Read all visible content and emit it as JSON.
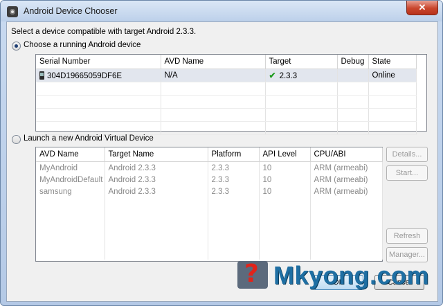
{
  "window": {
    "title": "Android Device Chooser",
    "close_label": "✕"
  },
  "instructions": "Select a device compatible with target Android 2.3.3.",
  "running": {
    "radio_label": "Choose a running Android device",
    "columns": [
      "Serial Number",
      "AVD Name",
      "Target",
      "Debug",
      "State"
    ],
    "rows": [
      {
        "serial": "304D19665059DF6E",
        "avd": "N/A",
        "target": "2.3.3",
        "debug": "",
        "state": "Online",
        "icon": "phone-icon",
        "target_icon": "check-icon"
      }
    ]
  },
  "launch": {
    "radio_label": "Launch a new Android Virtual Device",
    "columns": [
      "AVD Name",
      "Target Name",
      "Platform",
      "API Level",
      "CPU/ABI"
    ],
    "rows": [
      {
        "avd": "MyAndroid",
        "target": "Android 2.3.3",
        "platform": "2.3.3",
        "api": "10",
        "cpu": "ARM (armeabi)"
      },
      {
        "avd": "MyAndroidDefault",
        "target": "Android 2.3.3",
        "platform": "2.3.3",
        "api": "10",
        "cpu": "ARM (armeabi)"
      },
      {
        "avd": "samsung",
        "target": "Android 2.3.3",
        "platform": "2.3.3",
        "api": "10",
        "cpu": "ARM (armeabi)"
      }
    ],
    "buttons": {
      "details": "Details...",
      "start": "Start...",
      "refresh": "Refresh",
      "manager": "Manager..."
    }
  },
  "footer": {
    "ok": "OK",
    "cancel": "Cancel"
  },
  "watermark": {
    "text": "Mkyong.com",
    "glyph": "?"
  }
}
